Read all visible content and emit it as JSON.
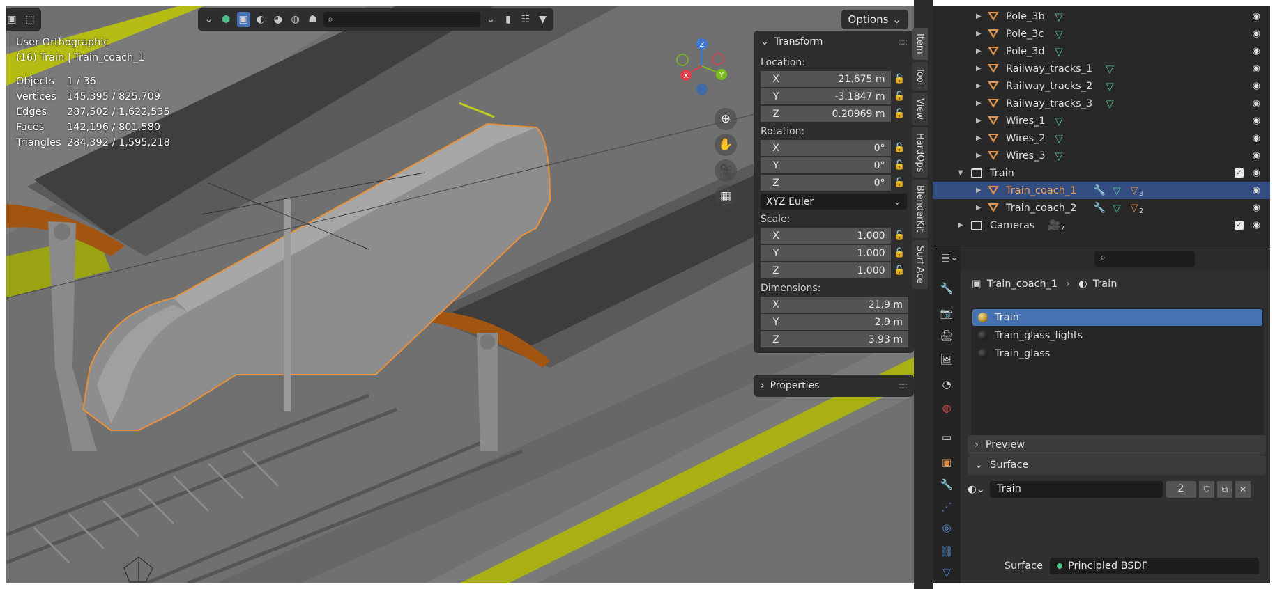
{
  "viewport": {
    "view_name": "User Orthographic",
    "object_context": "(16) Train | Train_coach_1",
    "stats": [
      {
        "label": "Objects",
        "value": "1 / 36"
      },
      {
        "label": "Vertices",
        "value": "145,395 / 825,709"
      },
      {
        "label": "Edges",
        "value": "287,502 / 1,622,535"
      },
      {
        "label": "Faces",
        "value": "142,196 / 801,580"
      },
      {
        "label": "Triangles",
        "value": "284,392 / 1,595,218"
      }
    ],
    "options_label": "Options",
    "gizmo": {
      "x": "X",
      "y": "Y",
      "z": "Z"
    }
  },
  "n_panel": {
    "transform_title": "Transform",
    "location_label": "Location:",
    "location": [
      {
        "axis": "X",
        "value": "21.675 m"
      },
      {
        "axis": "Y",
        "value": "-3.1847 m"
      },
      {
        "axis": "Z",
        "value": "0.20969 m"
      }
    ],
    "rotation_label": "Rotation:",
    "rotation": [
      {
        "axis": "X",
        "value": "0°"
      },
      {
        "axis": "Y",
        "value": "0°"
      },
      {
        "axis": "Z",
        "value": "0°"
      }
    ],
    "rotation_mode": "XYZ Euler",
    "scale_label": "Scale:",
    "scale": [
      {
        "axis": "X",
        "value": "1.000"
      },
      {
        "axis": "Y",
        "value": "1.000"
      },
      {
        "axis": "Z",
        "value": "1.000"
      }
    ],
    "dimensions_label": "Dimensions:",
    "dimensions": [
      {
        "axis": "X",
        "value": "21.9 m"
      },
      {
        "axis": "Y",
        "value": "2.9 m"
      },
      {
        "axis": "Z",
        "value": "3.93 m"
      }
    ],
    "properties_title": "Properties",
    "tabs": [
      "Item",
      "Tool",
      "View",
      "HardOps",
      "BlenderKit",
      "Surf Ace"
    ]
  },
  "outliner": {
    "rows": [
      {
        "name": "Pole_3b",
        "type": "mesh"
      },
      {
        "name": "Pole_3c",
        "type": "mesh"
      },
      {
        "name": "Pole_3d",
        "type": "mesh"
      },
      {
        "name": "Railway_tracks_1",
        "type": "mesh"
      },
      {
        "name": "Railway_tracks_2",
        "type": "mesh"
      },
      {
        "name": "Railway_tracks_3",
        "type": "mesh"
      },
      {
        "name": "Wires_1",
        "type": "mesh"
      },
      {
        "name": "Wires_2",
        "type": "mesh"
      },
      {
        "name": "Wires_3",
        "type": "mesh"
      },
      {
        "name": "Train",
        "type": "collection"
      },
      {
        "name": "Train_coach_1",
        "type": "mesh",
        "material_count": "3",
        "selected": true
      },
      {
        "name": "Train_coach_2",
        "type": "mesh",
        "material_count": "2"
      },
      {
        "name": "Cameras",
        "type": "collection",
        "camera_count": "7"
      }
    ]
  },
  "properties": {
    "breadcrumb_object": "Train_coach_1",
    "breadcrumb_material": "Train",
    "material_slots": [
      "Train",
      "Train_glass_lights",
      "Train_glass"
    ],
    "material_name": "Train",
    "user_count": "2",
    "preview_label": "Preview",
    "surface_panel_label": "Surface",
    "surface_label": "Surface",
    "surface_shader": "Principled BSDF"
  },
  "colors": {
    "selection_outline": "#e8913a",
    "active_tab": "#4772b3",
    "mesh_icon": "#e09349",
    "data_icon": "#4fc18a"
  }
}
